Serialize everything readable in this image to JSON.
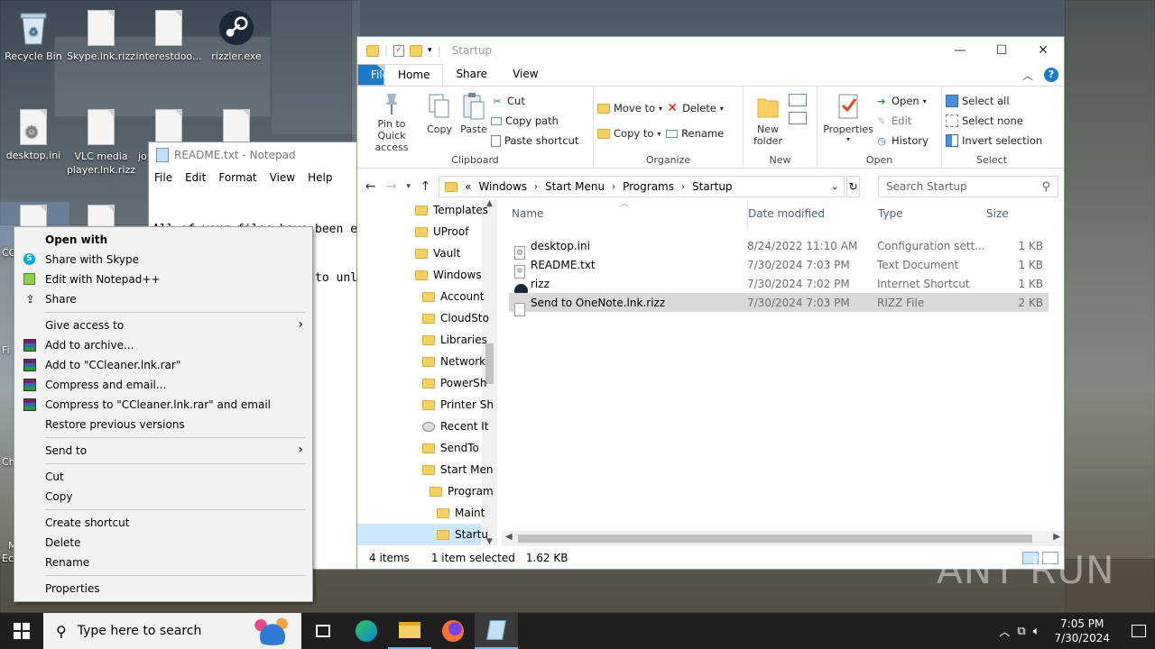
{
  "desktop": {
    "icons": [
      {
        "label": "Recycle Bin"
      },
      {
        "label": "Skype.lnk.rizz"
      },
      {
        "label": "interestdoo..."
      },
      {
        "label": "rizzler.exe"
      },
      {
        "label": "desktop.ini"
      },
      {
        "label": "VLC media player.lnk.rizz"
      }
    ],
    "edge_fragments": [
      "jo",
      "CC",
      "Fi",
      "Ch",
      "M",
      "Ec"
    ]
  },
  "notepad": {
    "title": "README.txt - Notepad",
    "menu": [
      "File",
      "Edit",
      "Format",
      "View",
      "Help"
    ],
    "lines": [
      "All of your files have been e",
      "You need RIZZ Level 99 to unl"
    ]
  },
  "context_menu": {
    "items": [
      {
        "label": "Open with",
        "bold": true,
        "icon": ""
      },
      {
        "label": "Share with Skype",
        "icon": "skype-icon"
      },
      {
        "label": "Edit with Notepad++",
        "icon": "notepadpp-icon"
      },
      {
        "label": "Share",
        "icon": "share-icon"
      },
      {
        "sep": true
      },
      {
        "label": "Give access to",
        "submenu": true
      },
      {
        "label": "Add to archive...",
        "icon": "winrar-icon"
      },
      {
        "label": "Add to \"CCleaner.lnk.rar\"",
        "icon": "winrar-icon"
      },
      {
        "label": "Compress and email...",
        "icon": "winrar-icon"
      },
      {
        "label": "Compress to \"CCleaner.lnk.rar\" and email",
        "icon": "winrar-icon"
      },
      {
        "label": "Restore previous versions"
      },
      {
        "sep": true
      },
      {
        "label": "Send to",
        "submenu": true
      },
      {
        "sep": true
      },
      {
        "label": "Cut"
      },
      {
        "label": "Copy"
      },
      {
        "sep": true
      },
      {
        "label": "Create shortcut"
      },
      {
        "label": "Delete"
      },
      {
        "label": "Rename"
      },
      {
        "sep": true
      },
      {
        "label": "Properties"
      }
    ]
  },
  "explorer": {
    "title": "Startup",
    "tabs": [
      "File",
      "Home",
      "Share",
      "View"
    ],
    "ribbon": {
      "clipboard": {
        "label": "Clipboard",
        "pin": "Pin to Quick access",
        "copy": "Copy",
        "paste": "Paste",
        "cut": "Cut",
        "copy_path": "Copy path",
        "paste_shortcut": "Paste shortcut"
      },
      "organize": {
        "label": "Organize",
        "move_to": "Move to",
        "copy_to": "Copy to",
        "delete": "Delete",
        "rename": "Rename"
      },
      "new": {
        "label": "New",
        "new_folder": "New folder"
      },
      "open": {
        "label": "Open",
        "properties": "Properties",
        "open": "Open",
        "edit": "Edit",
        "history": "History"
      },
      "select": {
        "label": "Select",
        "select_all": "Select all",
        "select_none": "Select none",
        "invert": "Invert selection"
      }
    },
    "path": [
      "Windows",
      "Start Menu",
      "Programs",
      "Startup"
    ],
    "path_prefix": "«",
    "search_placeholder": "Search Startup",
    "nav": [
      {
        "label": "Templates",
        "indent": 0
      },
      {
        "label": "UProof",
        "indent": 0
      },
      {
        "label": "Vault",
        "indent": 0
      },
      {
        "label": "Windows",
        "indent": 0
      },
      {
        "label": "Account",
        "indent": 1
      },
      {
        "label": "CloudSto",
        "indent": 1
      },
      {
        "label": "Libraries",
        "indent": 1
      },
      {
        "label": "Network",
        "indent": 1
      },
      {
        "label": "PowerSh",
        "indent": 1
      },
      {
        "label": "Printer Sh",
        "indent": 1
      },
      {
        "label": "Recent It",
        "indent": 1
      },
      {
        "label": "SendTo",
        "indent": 1
      },
      {
        "label": "Start Men",
        "indent": 1
      },
      {
        "label": "Program",
        "indent": 2
      },
      {
        "label": "Maint",
        "indent": 3
      },
      {
        "label": "Startu",
        "indent": 3
      }
    ],
    "columns": [
      "Name",
      "Date modified",
      "Type",
      "Size"
    ],
    "files": [
      {
        "name": "desktop.ini",
        "date": "8/24/2022 11:10 AM",
        "type": "Configuration sett...",
        "size": "1 KB",
        "icon": "settings-file-icon"
      },
      {
        "name": "README.txt",
        "date": "7/30/2024 7:03 PM",
        "type": "Text Document",
        "size": "1 KB",
        "icon": "text-file-icon"
      },
      {
        "name": "rizz",
        "date": "7/30/2024 7:02 PM",
        "type": "Internet Shortcut",
        "size": "1 KB",
        "icon": "steam-icon"
      },
      {
        "name": "Send to OneNote.lnk.rizz",
        "date": "7/30/2024 7:03 PM",
        "type": "RIZZ File",
        "size": "2 KB",
        "icon": "blank-file-icon"
      }
    ],
    "status": {
      "count": "4 items",
      "selected": "1 item selected",
      "size": "1.62 KB"
    }
  },
  "taskbar": {
    "search_placeholder": "Type here to search",
    "time": "7:05 PM",
    "date": "7/30/2024"
  },
  "watermark": "ANY RUN"
}
